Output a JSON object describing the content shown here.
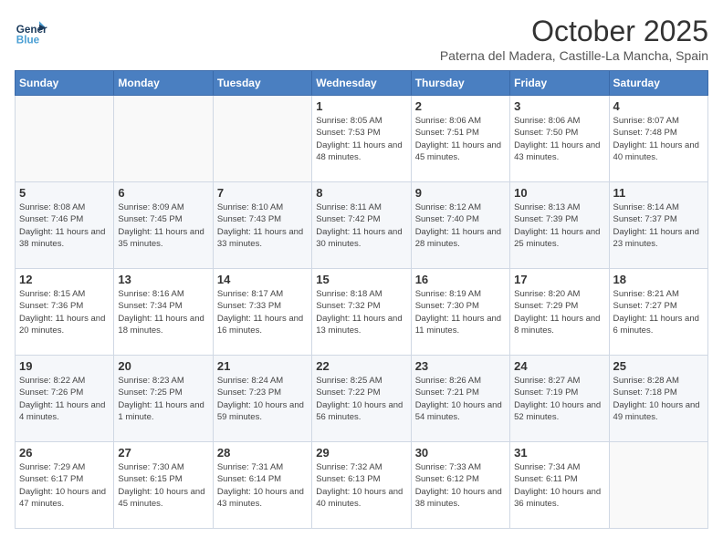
{
  "header": {
    "logo_line1": "General",
    "logo_line2": "Blue",
    "month": "October 2025",
    "location": "Paterna del Madera, Castille-La Mancha, Spain"
  },
  "days_of_week": [
    "Sunday",
    "Monday",
    "Tuesday",
    "Wednesday",
    "Thursday",
    "Friday",
    "Saturday"
  ],
  "weeks": [
    [
      {
        "num": "",
        "info": ""
      },
      {
        "num": "",
        "info": ""
      },
      {
        "num": "",
        "info": ""
      },
      {
        "num": "1",
        "info": "Sunrise: 8:05 AM\nSunset: 7:53 PM\nDaylight: 11 hours and 48 minutes."
      },
      {
        "num": "2",
        "info": "Sunrise: 8:06 AM\nSunset: 7:51 PM\nDaylight: 11 hours and 45 minutes."
      },
      {
        "num": "3",
        "info": "Sunrise: 8:06 AM\nSunset: 7:50 PM\nDaylight: 11 hours and 43 minutes."
      },
      {
        "num": "4",
        "info": "Sunrise: 8:07 AM\nSunset: 7:48 PM\nDaylight: 11 hours and 40 minutes."
      }
    ],
    [
      {
        "num": "5",
        "info": "Sunrise: 8:08 AM\nSunset: 7:46 PM\nDaylight: 11 hours and 38 minutes."
      },
      {
        "num": "6",
        "info": "Sunrise: 8:09 AM\nSunset: 7:45 PM\nDaylight: 11 hours and 35 minutes."
      },
      {
        "num": "7",
        "info": "Sunrise: 8:10 AM\nSunset: 7:43 PM\nDaylight: 11 hours and 33 minutes."
      },
      {
        "num": "8",
        "info": "Sunrise: 8:11 AM\nSunset: 7:42 PM\nDaylight: 11 hours and 30 minutes."
      },
      {
        "num": "9",
        "info": "Sunrise: 8:12 AM\nSunset: 7:40 PM\nDaylight: 11 hours and 28 minutes."
      },
      {
        "num": "10",
        "info": "Sunrise: 8:13 AM\nSunset: 7:39 PM\nDaylight: 11 hours and 25 minutes."
      },
      {
        "num": "11",
        "info": "Sunrise: 8:14 AM\nSunset: 7:37 PM\nDaylight: 11 hours and 23 minutes."
      }
    ],
    [
      {
        "num": "12",
        "info": "Sunrise: 8:15 AM\nSunset: 7:36 PM\nDaylight: 11 hours and 20 minutes."
      },
      {
        "num": "13",
        "info": "Sunrise: 8:16 AM\nSunset: 7:34 PM\nDaylight: 11 hours and 18 minutes."
      },
      {
        "num": "14",
        "info": "Sunrise: 8:17 AM\nSunset: 7:33 PM\nDaylight: 11 hours and 16 minutes."
      },
      {
        "num": "15",
        "info": "Sunrise: 8:18 AM\nSunset: 7:32 PM\nDaylight: 11 hours and 13 minutes."
      },
      {
        "num": "16",
        "info": "Sunrise: 8:19 AM\nSunset: 7:30 PM\nDaylight: 11 hours and 11 minutes."
      },
      {
        "num": "17",
        "info": "Sunrise: 8:20 AM\nSunset: 7:29 PM\nDaylight: 11 hours and 8 minutes."
      },
      {
        "num": "18",
        "info": "Sunrise: 8:21 AM\nSunset: 7:27 PM\nDaylight: 11 hours and 6 minutes."
      }
    ],
    [
      {
        "num": "19",
        "info": "Sunrise: 8:22 AM\nSunset: 7:26 PM\nDaylight: 11 hours and 4 minutes."
      },
      {
        "num": "20",
        "info": "Sunrise: 8:23 AM\nSunset: 7:25 PM\nDaylight: 11 hours and 1 minute."
      },
      {
        "num": "21",
        "info": "Sunrise: 8:24 AM\nSunset: 7:23 PM\nDaylight: 10 hours and 59 minutes."
      },
      {
        "num": "22",
        "info": "Sunrise: 8:25 AM\nSunset: 7:22 PM\nDaylight: 10 hours and 56 minutes."
      },
      {
        "num": "23",
        "info": "Sunrise: 8:26 AM\nSunset: 7:21 PM\nDaylight: 10 hours and 54 minutes."
      },
      {
        "num": "24",
        "info": "Sunrise: 8:27 AM\nSunset: 7:19 PM\nDaylight: 10 hours and 52 minutes."
      },
      {
        "num": "25",
        "info": "Sunrise: 8:28 AM\nSunset: 7:18 PM\nDaylight: 10 hours and 49 minutes."
      }
    ],
    [
      {
        "num": "26",
        "info": "Sunrise: 7:29 AM\nSunset: 6:17 PM\nDaylight: 10 hours and 47 minutes."
      },
      {
        "num": "27",
        "info": "Sunrise: 7:30 AM\nSunset: 6:15 PM\nDaylight: 10 hours and 45 minutes."
      },
      {
        "num": "28",
        "info": "Sunrise: 7:31 AM\nSunset: 6:14 PM\nDaylight: 10 hours and 43 minutes."
      },
      {
        "num": "29",
        "info": "Sunrise: 7:32 AM\nSunset: 6:13 PM\nDaylight: 10 hours and 40 minutes."
      },
      {
        "num": "30",
        "info": "Sunrise: 7:33 AM\nSunset: 6:12 PM\nDaylight: 10 hours and 38 minutes."
      },
      {
        "num": "31",
        "info": "Sunrise: 7:34 AM\nSunset: 6:11 PM\nDaylight: 10 hours and 36 minutes."
      },
      {
        "num": "",
        "info": ""
      }
    ]
  ]
}
